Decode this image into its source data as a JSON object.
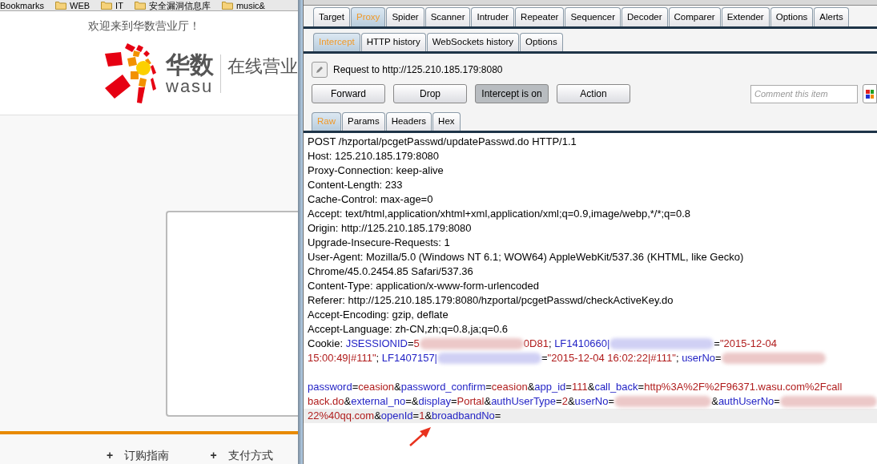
{
  "browser": {
    "bookmarks": [
      {
        "label": "Bookmarks",
        "folder": false
      },
      {
        "label": "WEB",
        "folder": true
      },
      {
        "label": "IT",
        "folder": true
      },
      {
        "label": "安全漏洞信息库",
        "folder": true
      },
      {
        "label": "music&",
        "folder": true
      }
    ],
    "welcome": "欢迎来到华数营业厅！",
    "logo_cn": "华数",
    "logo_en": "wasu",
    "logo_tagline": "在线营业",
    "footer_links": [
      {
        "icon": "+",
        "label": "订购指南"
      },
      {
        "icon": "+",
        "label": "支付方式"
      }
    ]
  },
  "burp": {
    "tabs": [
      {
        "label": "Target",
        "selected": false
      },
      {
        "label": "Proxy",
        "selected": true
      },
      {
        "label": "Spider",
        "selected": false
      },
      {
        "label": "Scanner",
        "selected": false
      },
      {
        "label": "Intruder",
        "selected": false
      },
      {
        "label": "Repeater",
        "selected": false
      },
      {
        "label": "Sequencer",
        "selected": false
      },
      {
        "label": "Decoder",
        "selected": false
      },
      {
        "label": "Comparer",
        "selected": false
      },
      {
        "label": "Extender",
        "selected": false
      },
      {
        "label": "Options",
        "selected": false
      },
      {
        "label": "Alerts",
        "selected": false
      }
    ],
    "subtabs": [
      {
        "label": "Intercept",
        "selected": true
      },
      {
        "label": "HTTP history",
        "selected": false
      },
      {
        "label": "WebSockets history",
        "selected": false
      },
      {
        "label": "Options",
        "selected": false
      }
    ],
    "request_to": "Request to http://125.210.185.179:8080",
    "buttons": [
      {
        "label": "Forward",
        "pressed": false
      },
      {
        "label": "Drop",
        "pressed": false
      },
      {
        "label": "Intercept is on",
        "pressed": true
      },
      {
        "label": "Action",
        "pressed": false
      }
    ],
    "comment": {
      "placeholder": "Comment this item"
    },
    "view_tabs": [
      {
        "label": "Raw",
        "selected": true
      },
      {
        "label": "Params",
        "selected": false
      },
      {
        "label": "Headers",
        "selected": false
      },
      {
        "label": "Hex",
        "selected": false
      }
    ],
    "header_lines": [
      {
        "highlighted": false,
        "segments": [
          {
            "kind": "plain",
            "text": "POST /hzportal/pcgetPasswd/updatePasswd.do HTTP/1.1"
          }
        ]
      },
      {
        "highlighted": false,
        "segments": [
          {
            "kind": "plain",
            "text": "Host: 125.210.185.179:8080"
          }
        ]
      },
      {
        "highlighted": false,
        "segments": [
          {
            "kind": "plain",
            "text": "Proxy-Connection: keep-alive"
          }
        ]
      },
      {
        "highlighted": false,
        "segments": [
          {
            "kind": "plain",
            "text": "Content-Length: 233"
          }
        ]
      },
      {
        "highlighted": false,
        "segments": [
          {
            "kind": "plain",
            "text": "Cache-Control: max-age=0"
          }
        ]
      },
      {
        "highlighted": false,
        "segments": [
          {
            "kind": "plain",
            "text": "Accept: text/html,application/xhtml+xml,application/xml;q=0.9,image/webp,*/*;q=0.8"
          }
        ]
      },
      {
        "highlighted": false,
        "segments": [
          {
            "kind": "plain",
            "text": "Origin: http://125.210.185.179:8080"
          }
        ]
      },
      {
        "highlighted": false,
        "segments": [
          {
            "kind": "plain",
            "text": "Upgrade-Insecure-Requests: 1"
          }
        ]
      },
      {
        "highlighted": false,
        "segments": [
          {
            "kind": "plain",
            "text": "User-Agent: Mozilla/5.0 (Windows NT 6.1; WOW64) AppleWebKit/537.36 (KHTML, like Gecko)"
          }
        ]
      },
      {
        "highlighted": false,
        "segments": [
          {
            "kind": "plain",
            "text": "Chrome/45.0.2454.85 Safari/537.36"
          }
        ]
      },
      {
        "highlighted": false,
        "segments": [
          {
            "kind": "plain",
            "text": "Content-Type: application/x-www-form-urlencoded"
          }
        ]
      },
      {
        "highlighted": false,
        "segments": [
          {
            "kind": "plain",
            "text": "Referer: http://125.210.185.179:8080/hzportal/pcgetPasswd/checkActiveKey.do"
          }
        ]
      },
      {
        "highlighted": false,
        "segments": [
          {
            "kind": "plain",
            "text": "Accept-Encoding: gzip, deflate"
          }
        ]
      },
      {
        "highlighted": false,
        "segments": [
          {
            "kind": "plain",
            "text": "Accept-Language: zh-CN,zh;q=0.8,ja;q=0.6"
          }
        ]
      },
      {
        "highlighted": false,
        "segments": [
          {
            "kind": "plain",
            "text": "Cookie: "
          },
          {
            "kind": "name",
            "text": "JSESSIONID"
          },
          {
            "kind": "plain",
            "text": "="
          },
          {
            "kind": "value",
            "text": "5"
          },
          {
            "kind": "redacted",
            "color": "#ecc8c8"
          },
          {
            "kind": "value",
            "text": "0D81"
          },
          {
            "kind": "plain",
            "text": "; "
          },
          {
            "kind": "name",
            "text": "LF1410660|"
          },
          {
            "kind": "redacted",
            "color": "#d0d0f4"
          },
          {
            "kind": "plain",
            "text": "="
          },
          {
            "kind": "value",
            "text": "\"2015-12-04"
          }
        ]
      },
      {
        "highlighted": false,
        "segments": [
          {
            "kind": "value",
            "text": "15:00:49|#111\""
          },
          {
            "kind": "plain",
            "text": "; "
          },
          {
            "kind": "name",
            "text": "LF1407157|"
          },
          {
            "kind": "redacted",
            "color": "#d0d0f4"
          },
          {
            "kind": "plain",
            "text": "="
          },
          {
            "kind": "value",
            "text": "\"2015-12-04 16:02:22|#111\""
          },
          {
            "kind": "plain",
            "text": "; "
          },
          {
            "kind": "name",
            "text": "userNo"
          },
          {
            "kind": "plain",
            "text": "="
          },
          {
            "kind": "redacted",
            "color": "#ecc8c8"
          }
        ]
      }
    ],
    "body_lines": [
      {
        "highlighted": false,
        "segments": [
          {
            "kind": "name",
            "text": "password"
          },
          {
            "kind": "plain",
            "text": "="
          },
          {
            "kind": "value",
            "text": "ceasion"
          },
          {
            "kind": "plain",
            "text": "&"
          },
          {
            "kind": "name",
            "text": "password_confirm"
          },
          {
            "kind": "plain",
            "text": "="
          },
          {
            "kind": "value",
            "text": "ceasion"
          },
          {
            "kind": "plain",
            "text": "&"
          },
          {
            "kind": "name",
            "text": "app_id"
          },
          {
            "kind": "plain",
            "text": "="
          },
          {
            "kind": "value",
            "text": "111"
          },
          {
            "kind": "plain",
            "text": "&"
          },
          {
            "kind": "name",
            "text": "call_back"
          },
          {
            "kind": "plain",
            "text": "="
          },
          {
            "kind": "value",
            "text": "http%3A%2F%2F96371.wasu.com%2Fcall"
          }
        ]
      },
      {
        "highlighted": false,
        "segments": [
          {
            "kind": "value",
            "text": "back.do"
          },
          {
            "kind": "plain",
            "text": "&"
          },
          {
            "kind": "name",
            "text": "external_no"
          },
          {
            "kind": "plain",
            "text": "=&"
          },
          {
            "kind": "name",
            "text": "display"
          },
          {
            "kind": "plain",
            "text": "="
          },
          {
            "kind": "value",
            "text": "Portal"
          },
          {
            "kind": "plain",
            "text": "&"
          },
          {
            "kind": "name",
            "text": "authUserType"
          },
          {
            "kind": "plain",
            "text": "="
          },
          {
            "kind": "value",
            "text": "2"
          },
          {
            "kind": "plain",
            "text": "&"
          },
          {
            "kind": "name",
            "text": "userNo"
          },
          {
            "kind": "plain",
            "text": "="
          },
          {
            "kind": "redacted",
            "color": "#ecc8c8"
          },
          {
            "kind": "plain",
            "text": "&"
          },
          {
            "kind": "name",
            "text": "authUserNo"
          },
          {
            "kind": "plain",
            "text": "="
          },
          {
            "kind": "redacted",
            "color": "#ecc8c8"
          }
        ]
      },
      {
        "highlighted": true,
        "segments": [
          {
            "kind": "value",
            "text": "22%40qq.com"
          },
          {
            "kind": "plain",
            "text": "&"
          },
          {
            "kind": "name",
            "text": "openId"
          },
          {
            "kind": "plain",
            "text": "="
          },
          {
            "kind": "value",
            "text": "1"
          },
          {
            "kind": "plain",
            "text": "&"
          },
          {
            "kind": "name",
            "text": "broadbandNo"
          },
          {
            "kind": "plain",
            "text": "="
          }
        ]
      }
    ]
  }
}
